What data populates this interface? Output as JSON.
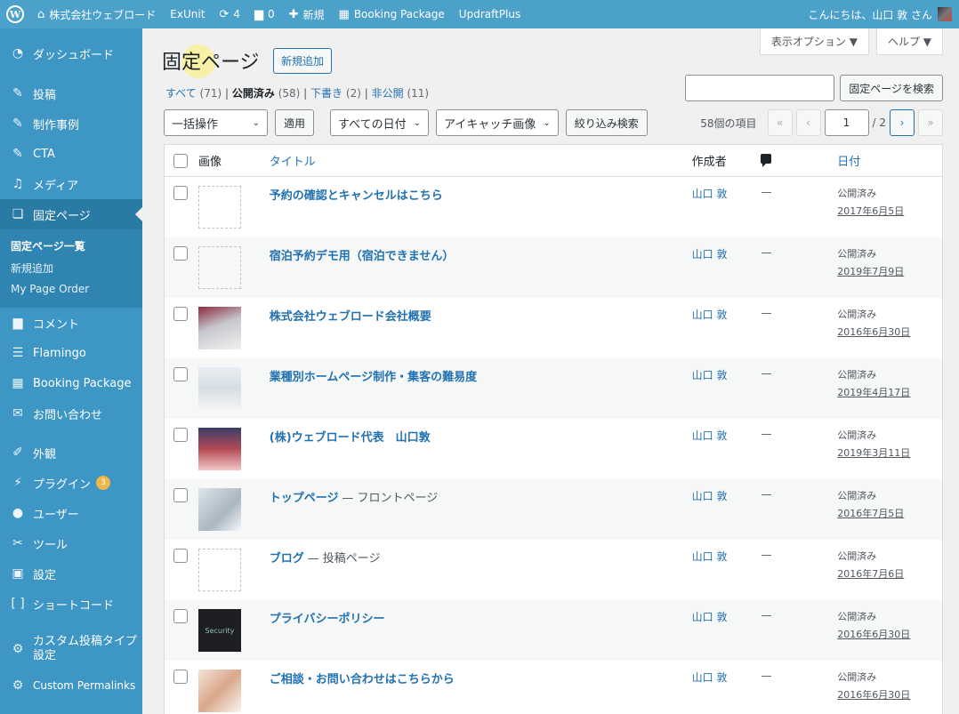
{
  "adminbar": {
    "site_name": "株式会社ウェブロード",
    "exunit": "ExUnit",
    "updates_count": "4",
    "comments_count": "0",
    "new_label": "新規",
    "booking": "Booking Package",
    "updraft": "UpdraftPlus",
    "greeting": "こんにちは、山口 敦 さん"
  },
  "sidebar": {
    "dashboard": "ダッシュボード",
    "posts": "投稿",
    "works": "制作事例",
    "cta": "CTA",
    "media": "メディア",
    "pages": "固定ページ",
    "sub_all_pages": "固定ページ一覧",
    "sub_add_new": "新規追加",
    "sub_order": "My Page Order",
    "comments": "コメント",
    "flamingo": "Flamingo",
    "booking": "Booking Package",
    "contact": "お問い合わせ",
    "appearance": "外観",
    "plugins": "プラグイン",
    "plugins_badge": "3",
    "users": "ユーザー",
    "tools": "ツール",
    "settings": "設定",
    "shortcode": "ショートコード",
    "cpt_line1": "カスタム投稿タイプ",
    "cpt_line2": "設定",
    "permalinks": "Custom Permalinks"
  },
  "screen": {
    "options": "表示オプション ▼",
    "help": "ヘルプ ▼"
  },
  "page": {
    "title": "固定ページ",
    "add_new": "新規追加",
    "search_button": "固定ページを検索",
    "search_value": ""
  },
  "filters": {
    "all": "すべて",
    "all_count": "(71)",
    "published": "公開済み",
    "published_count": "(58)",
    "draft": "下書き",
    "draft_count": "(2)",
    "private": "非公開",
    "private_count": "(11)",
    "sep": "|"
  },
  "tablenav": {
    "bulk": "一括操作",
    "apply": "適用",
    "dates": "すべての日付",
    "eyecatch": "アイキャッチ画像",
    "filter": "絞り込み検索",
    "items": "58個の項目",
    "first": "«",
    "prev": "‹",
    "current_page": "1",
    "total_pages": "/ 2",
    "next": "›",
    "last": "»"
  },
  "table": {
    "headers": {
      "image": "画像",
      "title": "タイトル",
      "author": "作成者",
      "date": "日付"
    },
    "rows": [
      {
        "title": "予約の確認とキャンセルはこちら",
        "state": "",
        "author": "山口 敦",
        "comments": "—",
        "status": "公開済み",
        "date": "2017年6月5日",
        "thumb": "none"
      },
      {
        "title": "宿泊予約デモ用（宿泊できません）",
        "state": "",
        "author": "山口 敦",
        "comments": "—",
        "status": "公開済み",
        "date": "2019年7月9日",
        "thumb": "none"
      },
      {
        "title": "株式会社ウェブロード会社概要",
        "state": "",
        "author": "山口 敦",
        "comments": "—",
        "status": "公開済み",
        "date": "2016年6月30日",
        "thumb": "office"
      },
      {
        "title": "業種別ホームページ制作・集客の難易度",
        "state": "",
        "author": "山口 敦",
        "comments": "—",
        "status": "公開済み",
        "date": "2019年4月17日",
        "thumb": "meeting"
      },
      {
        "title": "(株)ウェブロード代表　山口敦",
        "state": "",
        "author": "山口 敦",
        "comments": "—",
        "status": "公開済み",
        "date": "2019年3月11日",
        "thumb": "people"
      },
      {
        "title": "トップページ",
        "state": "— フロントページ",
        "author": "山口 敦",
        "comments": "—",
        "status": "公開済み",
        "date": "2016年7月5日",
        "thumb": "laptop"
      },
      {
        "title": "ブログ",
        "state": "— 投稿ページ",
        "author": "山口 敦",
        "comments": "—",
        "status": "公開済み",
        "date": "2016年7月6日",
        "thumb": "none"
      },
      {
        "title": "プライバシーポリシー",
        "state": "",
        "author": "山口 敦",
        "comments": "—",
        "status": "公開済み",
        "date": "2016年6月30日",
        "thumb": "security"
      },
      {
        "title": "ご相談・お問い合わせはこちらから",
        "state": "",
        "author": "山口 敦",
        "comments": "—",
        "status": "公開済み",
        "date": "2016年6月30日",
        "thumb": "consult"
      }
    ]
  },
  "thumb_text": {
    "security": "Security"
  }
}
